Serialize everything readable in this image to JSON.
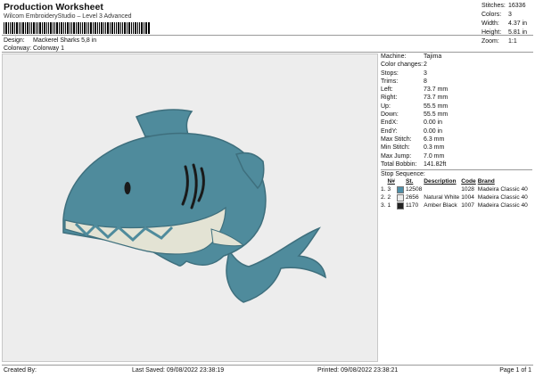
{
  "header": {
    "title": "Production Worksheet",
    "subtitle": "Wilcom EmbroideryStudio – Level 3 Advanced",
    "design_label": "Design:",
    "design_value": "Mackerel Sharks 5,8 in",
    "colorway_label": "Colorway:",
    "colorway_value": "Colorway 1"
  },
  "stats": [
    {
      "label": "Stitches:",
      "value": "16336"
    },
    {
      "label": "Colors:",
      "value": "3"
    },
    {
      "label": "Width:",
      "value": "4.37 in"
    },
    {
      "label": "Height:",
      "value": "5.81 in"
    },
    {
      "label": "Zoom:",
      "value": "1:1"
    }
  ],
  "machine_info": [
    {
      "label": "Machine:",
      "value": "Tajima"
    },
    {
      "label": "Color changes:",
      "value": "2"
    },
    {
      "label": "Stops:",
      "value": "3"
    },
    {
      "label": "Trims:",
      "value": "8"
    },
    {
      "label": "Left:",
      "value": "73.7 mm"
    },
    {
      "label": "Right:",
      "value": "73.7 mm"
    },
    {
      "label": "Up:",
      "value": "55.5 mm"
    },
    {
      "label": "Down:",
      "value": "55.5 mm"
    },
    {
      "label": "EndX:",
      "value": "0.00 in"
    },
    {
      "label": "EndY:",
      "value": "0.00 in"
    },
    {
      "label": "Max Stitch:",
      "value": "6.3 mm"
    },
    {
      "label": "Min Stitch:",
      "value": "0.3 mm"
    },
    {
      "label": "Max Jump:",
      "value": "7.0 mm"
    },
    {
      "label": "Total Bobbin:",
      "value": "141.82ft"
    }
  ],
  "stop_sequence": {
    "heading": "Stop Sequence:",
    "columns": [
      "",
      "N#",
      "St.",
      "Description",
      "Code",
      "Brand"
    ],
    "rows": [
      {
        "stop": "1.",
        "n": "3",
        "color": "#4f8fa8",
        "st": "12508",
        "desc": "",
        "code": "1028",
        "brand": "Madeira Classic 40"
      },
      {
        "stop": "2.",
        "n": "2",
        "color": "#ececec",
        "st": "2656",
        "desc": "Natural White",
        "code": "1004",
        "brand": "Madeira Classic 40"
      },
      {
        "stop": "3.",
        "n": "1",
        "color": "#222222",
        "st": "1170",
        "desc": "Amber Black",
        "code": "1007",
        "brand": "Madeira Classic 40"
      }
    ]
  },
  "footer": {
    "created_by": "Created By:",
    "last_saved": "Last Saved: 09/08/2022 23:38:19",
    "printed": "Printed: 09/08/2022 23:38:21",
    "page": "Page 1 of 1"
  },
  "colors": {
    "shark_body": "#4f8b9c",
    "shark_belly": "#e3e3d4",
    "outline": "#3e6f7d",
    "eye": "#1a1a1a"
  }
}
